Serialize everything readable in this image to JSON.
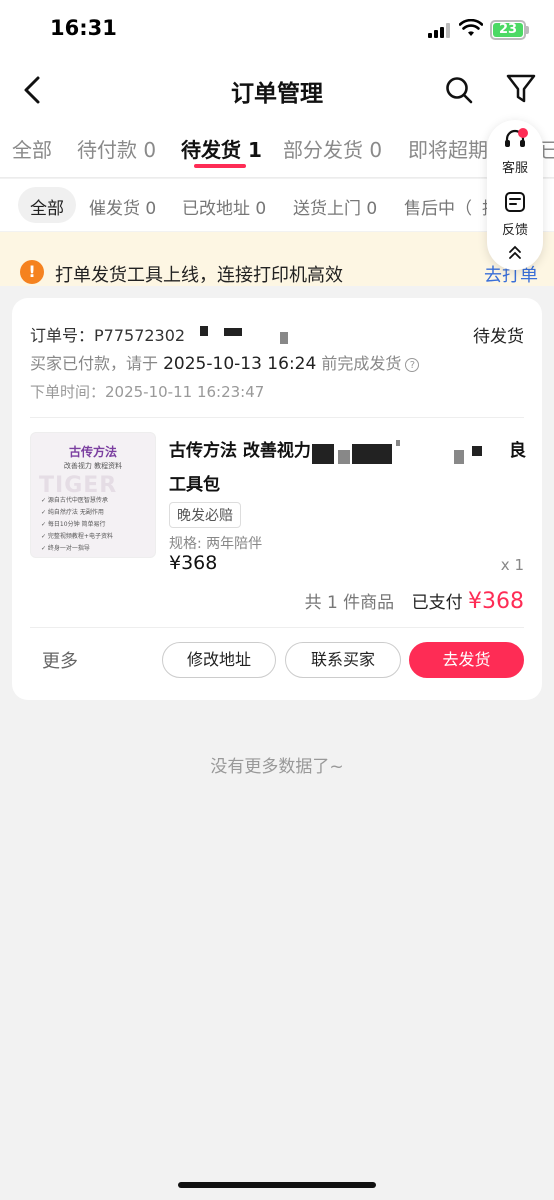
{
  "status_bar": {
    "time": "16:31",
    "battery": "23"
  },
  "navbar": {
    "title": "订单管理"
  },
  "tabs": [
    {
      "label": "全部"
    },
    {
      "label": "待付款 0"
    },
    {
      "label": "待发货 1"
    },
    {
      "label": "部分发货 0"
    },
    {
      "label": "即将超期"
    },
    {
      "label": "已"
    }
  ],
  "subtabs": [
    {
      "label": "全部"
    },
    {
      "label": "催发货 0"
    },
    {
      "label": "已改地址 0"
    },
    {
      "label": "送货上门 0"
    },
    {
      "label": "售后中（"
    },
    {
      "label": "拦"
    }
  ],
  "notice": {
    "text": "打单发货工具上线，连接打印机高效",
    "link": "去打单"
  },
  "float_panel": {
    "service_label": "客服",
    "feedback_label": "反馈"
  },
  "order": {
    "order_no": "订单号：P77572302",
    "status": "待发货",
    "pay_prefix": "买家已付款，请于",
    "pay_deadline": "2025-10-13 16:24",
    "pay_suffix": "前完成发货",
    "order_time": "下单时间：2025-10-11 16:23:47",
    "product": {
      "image_title": "古传方法",
      "image_subtitle": "改善视力 教程资料",
      "image_lines": [
        "✓ 源自古代中医智慧传承",
        "✓ 纯自然疗法 无副作用",
        "✓ 每日10分钟 简单易行",
        "✓ 完整视频教程+电子资料",
        "✓ 终身一对一指导"
      ],
      "title_line1": "古传方法 改善视力",
      "title_tail": "良",
      "title_line2": "工具包",
      "tag": "晚发必赔",
      "spec": "规格: 两年陪伴",
      "price": "¥368",
      "qty": "x 1"
    },
    "count_text": "共 1 件商品",
    "paid_label": "已支付",
    "paid_amount": "¥368",
    "actions": {
      "more": "更多",
      "modify_address": "修改地址",
      "contact_buyer": "联系买家",
      "ship": "去发货"
    }
  },
  "footer": {
    "no_more": "没有更多数据了~"
  }
}
